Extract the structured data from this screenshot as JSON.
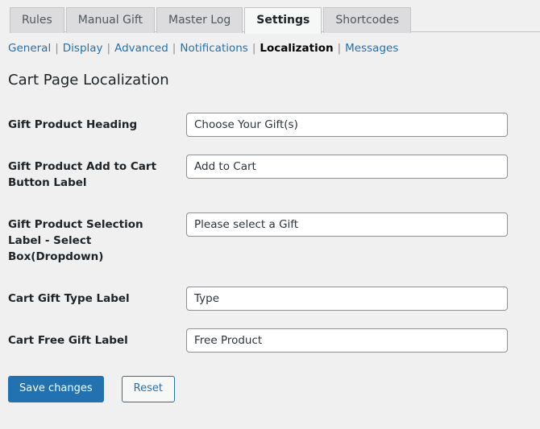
{
  "tabs": [
    {
      "label": "Rules",
      "active": false
    },
    {
      "label": "Manual Gift",
      "active": false
    },
    {
      "label": "Master Log",
      "active": false
    },
    {
      "label": "Settings",
      "active": true
    },
    {
      "label": "Shortcodes",
      "active": false
    }
  ],
  "subnav": {
    "separator": "|",
    "items": [
      {
        "label": "General",
        "current": false
      },
      {
        "label": "Display",
        "current": false
      },
      {
        "label": "Advanced",
        "current": false
      },
      {
        "label": "Notifications",
        "current": false
      },
      {
        "label": "Localization",
        "current": true
      },
      {
        "label": "Messages",
        "current": false
      }
    ]
  },
  "page": {
    "title": "Cart Page Localization"
  },
  "fields": [
    {
      "label": "Gift Product Heading",
      "value": "Choose Your Gift(s)"
    },
    {
      "label": "Gift Product Add to Cart Button Label",
      "value": "Add to Cart"
    },
    {
      "label": "Gift Product Selection Label - Select Box(Dropdown)",
      "value": "Please select a Gift"
    },
    {
      "label": "Cart Gift Type Label",
      "value": "Type"
    },
    {
      "label": "Cart Free Gift Label",
      "value": "Free Product"
    }
  ],
  "actions": {
    "save_label": "Save changes",
    "reset_label": "Reset"
  },
  "colors": {
    "primary": "#2271b1",
    "link": "#2271b1",
    "background": "#f0f0f1",
    "tab_inactive": "#dcdcde",
    "tab_active": "#f6f7f7",
    "border": "#c3c4c7",
    "input_border": "#8c8f94",
    "heading_text": "#1d2327"
  }
}
